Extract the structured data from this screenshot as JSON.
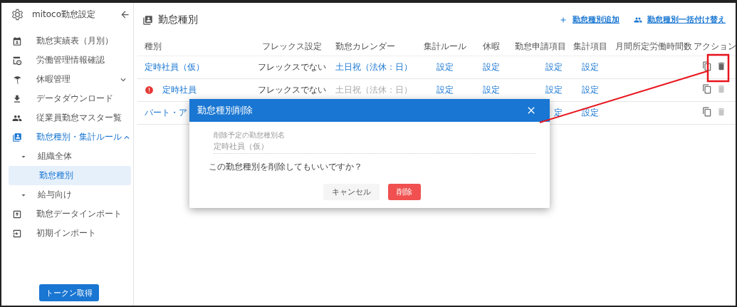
{
  "sidebar": {
    "title": "mitoco勤怠設定",
    "items": [
      {
        "label": "勤怠実績表（月別）",
        "selected": false
      },
      {
        "label": "労働管理情報確認",
        "selected": false
      },
      {
        "label": "休暇管理",
        "selected": false,
        "expanded": false
      },
      {
        "label": "データダウンロード",
        "selected": false
      },
      {
        "label": "従業員勤怠マスター覧",
        "selected": false
      },
      {
        "label": "勤怠種別・集計ルール",
        "selected": true,
        "expanded": true,
        "children": [
          {
            "label": "組織全体",
            "selected": false,
            "children": [
              {
                "label": "勤怠種別",
                "selected": true
              }
            ]
          },
          {
            "label": "給与向け",
            "selected": false
          }
        ]
      },
      {
        "label": "勤怠データインポート",
        "selected": false
      },
      {
        "label": "初期インポート",
        "selected": false
      }
    ],
    "button": "トークン取得"
  },
  "page": {
    "title": "勤怠種別",
    "actions": [
      "勤怠種別追加",
      "勤怠種別一括付け替え"
    ]
  },
  "table": {
    "columns": [
      "種別",
      "フレックス設定",
      "勤怠カレンダー",
      "集計ルール",
      "休暇",
      "勤怠申請項目",
      "集計項目",
      "月間所定労働時間数",
      "アクション"
    ],
    "rows": [
      {
        "warning": false,
        "delete_enabled": true,
        "name": "定時社員（仮）",
        "flex": "フレックスでない",
        "calendar": "土日祝（法休：日）",
        "calendar_disabled": false,
        "rule": "設定",
        "leave": "設定",
        "request": "設定",
        "totals": "設定"
      },
      {
        "warning": true,
        "delete_enabled": false,
        "name": "定時社員",
        "flex": "フレックスでない",
        "calendar": "土日祝（法休：日）",
        "calendar_disabled": true,
        "rule": "設定",
        "leave": "設定",
        "request": "設定",
        "totals": "設定"
      },
      {
        "warning": false,
        "delete_enabled": false,
        "name": "パート・ア",
        "request": "定",
        "totals": "設定"
      }
    ]
  },
  "dialog": {
    "title": "勤怠種別削除",
    "field_label": "削除予定の勤怠種別名",
    "field_value": "定時社員（仮）",
    "message": "この勤怠種別を削除してもいいですか？",
    "buttons": [
      {
        "label": "キャンセル",
        "kind": "flat"
      },
      {
        "label": "削除",
        "kind": "danger"
      }
    ]
  }
}
